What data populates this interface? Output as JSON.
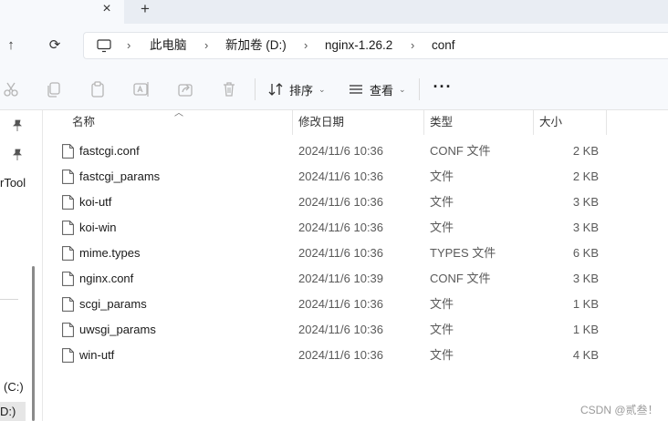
{
  "tabs": {
    "close_glyph": "×",
    "new_glyph": "+"
  },
  "nav": {
    "up_glyph": "↑",
    "refresh_glyph": "⟳"
  },
  "breadcrumb": [
    "此电脑",
    "新加卷 (D:)",
    "nginx-1.26.2",
    "conf"
  ],
  "breadcrumb_separator": "›",
  "toolbar": {
    "actions": [
      "cut-icon",
      "copy-icon",
      "paste-icon",
      "rename-icon",
      "share-icon",
      "delete-icon"
    ],
    "sort_label": "排序",
    "view_label": "查看",
    "more_label": "···",
    "caret": "⌄"
  },
  "sidebar": {
    "items": [
      "rTool",
      "(C:)",
      "D:)"
    ]
  },
  "columns": {
    "name": "名称",
    "date": "修改日期",
    "type": "类型",
    "size": "大小"
  },
  "files": [
    {
      "name": "fastcgi.conf",
      "date": "2024/11/6 10:36",
      "type": "CONF 文件",
      "size": "2 KB"
    },
    {
      "name": "fastcgi_params",
      "date": "2024/11/6 10:36",
      "type": "文件",
      "size": "2 KB"
    },
    {
      "name": "koi-utf",
      "date": "2024/11/6 10:36",
      "type": "文件",
      "size": "3 KB"
    },
    {
      "name": "koi-win",
      "date": "2024/11/6 10:36",
      "type": "文件",
      "size": "3 KB"
    },
    {
      "name": "mime.types",
      "date": "2024/11/6 10:36",
      "type": "TYPES 文件",
      "size": "6 KB"
    },
    {
      "name": "nginx.conf",
      "date": "2024/11/6 10:39",
      "type": "CONF 文件",
      "size": "3 KB"
    },
    {
      "name": "scgi_params",
      "date": "2024/11/6 10:36",
      "type": "文件",
      "size": "1 KB"
    },
    {
      "name": "uwsgi_params",
      "date": "2024/11/6 10:36",
      "type": "文件",
      "size": "1 KB"
    },
    {
      "name": "win-utf",
      "date": "2024/11/6 10:36",
      "type": "文件",
      "size": "4 KB"
    }
  ],
  "watermark": "CSDN @贰叁！",
  "colors": {
    "chrome_bg": "#f7f9fc",
    "tab_strip_bg": "#e9edf3",
    "icon_gray": "#b5b5b5",
    "text_secondary": "#5a5a5a"
  }
}
